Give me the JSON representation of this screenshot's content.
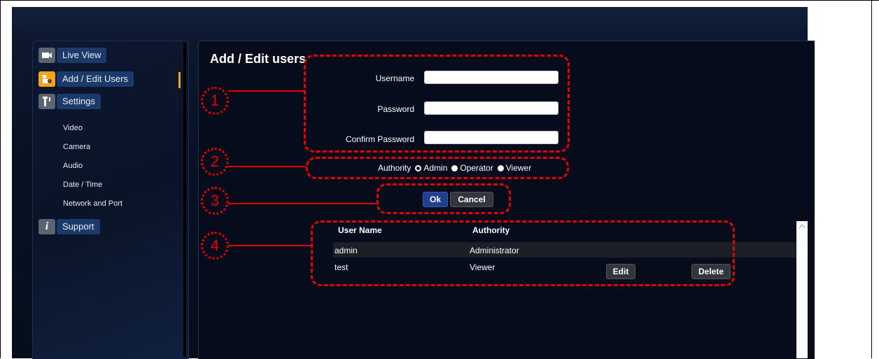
{
  "sidebar": {
    "items": [
      {
        "label": "Live View",
        "icon": "video-camera-icon"
      },
      {
        "label": "Add / Edit Users",
        "icon": "users-icon"
      },
      {
        "label": "Settings",
        "icon": "settings-tool-icon"
      },
      {
        "label": "Support",
        "icon": "info-icon"
      }
    ],
    "sub_items": [
      "Video",
      "Camera",
      "Audio",
      "Date / Time",
      "Network and Port"
    ]
  },
  "page": {
    "title": "Add / Edit users"
  },
  "form": {
    "username_label": "Username",
    "password_label": "Password",
    "confirm_label": "Confirm Password",
    "authority_label": "Authority",
    "authority_options": [
      "Admin",
      "Operator",
      "Viewer"
    ],
    "selected_authority": "Admin",
    "ok_label": "Ok",
    "cancel_label": "Cancel"
  },
  "users_table": {
    "headers": [
      "User Name",
      "Authority"
    ],
    "rows": [
      {
        "name": "admin",
        "authority": "Administrator"
      },
      {
        "name": "test",
        "authority": "Viewer",
        "edit": "Edit",
        "delete": "Delete"
      }
    ]
  },
  "callouts": [
    "1",
    "2",
    "3",
    "4"
  ],
  "colors": {
    "accent": "#f2a41d",
    "callout": "#e60000",
    "nav_label_bg": "#1b3a6b",
    "ok_button": "#1f3f8f"
  }
}
